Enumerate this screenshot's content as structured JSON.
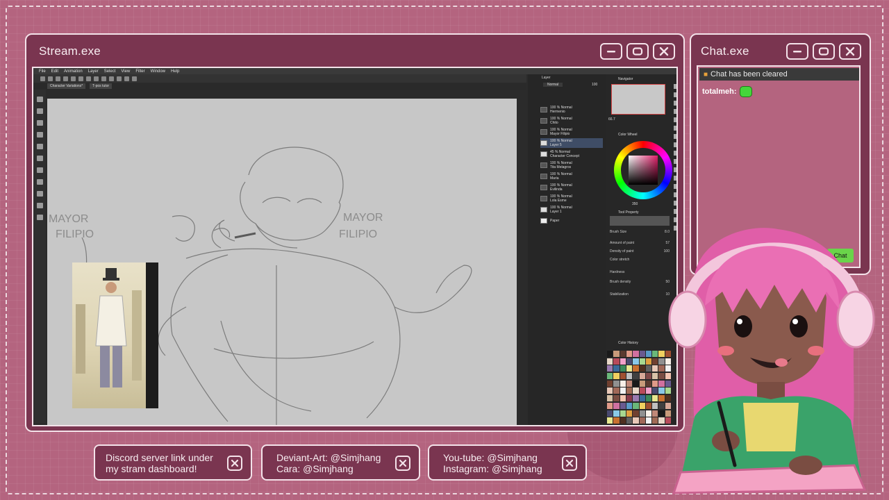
{
  "stream_window": {
    "title": "Stream.exe",
    "app": {
      "menu": [
        "File",
        "Edit",
        "Animation",
        "Layer",
        "Select",
        "View",
        "Filter",
        "Window",
        "Help"
      ],
      "tabs": [
        "Character Variations*",
        "T-pos tutor"
      ],
      "canvas_text": [
        "MAYOR",
        "FILIPIO",
        "MAYOR",
        "FILIPIO"
      ],
      "layers": [
        {
          "opacity": "100 %",
          "mode": "Normal",
          "name": "Hermenio"
        },
        {
          "opacity": "100 %",
          "mode": "Normal",
          "name": "Chito"
        },
        {
          "opacity": "100 %",
          "mode": "Normal",
          "name": "Mayor Filipio"
        },
        {
          "opacity": "100 %",
          "mode": "Normal",
          "name": "Layer 5"
        },
        {
          "opacity": "45 %",
          "mode": "Normal",
          "name": "Character Concept"
        },
        {
          "opacity": "100 %",
          "mode": "Normal",
          "name": "Tita Melagros"
        },
        {
          "opacity": "100 %",
          "mode": "Normal",
          "name": "Maria"
        },
        {
          "opacity": "100 %",
          "mode": "Normal",
          "name": "Evilinda"
        },
        {
          "opacity": "100 %",
          "mode": "Normal",
          "name": "Lola Esme"
        },
        {
          "opacity": "100 %",
          "mode": "Normal",
          "name": "Layer 1"
        },
        {
          "opacity": "",
          "mode": "",
          "name": "Paper"
        }
      ],
      "panels": {
        "layer": "Layer",
        "navigator": "Navigator",
        "color_wheel": "Color Wheel",
        "tool_property": "Tool Property",
        "color_history": "Color History"
      },
      "nav_zoom": "66.7",
      "color_value": "350",
      "tool_properties": [
        {
          "label": "Brush Size",
          "value": "8.0"
        },
        {
          "label": "Amount of paint",
          "value": "57"
        },
        {
          "label": "Density of paint",
          "value": "100"
        },
        {
          "label": "Color stretch",
          "value": ""
        },
        {
          "label": "Hardness",
          "value": ""
        },
        {
          "label": "Brush density",
          "value": "50"
        },
        {
          "label": "Stabilization",
          "value": "10"
        }
      ],
      "blend_mode": "Normal",
      "layer_opacity": "100"
    }
  },
  "chat_window": {
    "title": "Chat.exe",
    "cleared_notice": "Chat has been cleared",
    "messages": [
      {
        "user": "totalmeh:",
        "emote": "green-blob-emote"
      }
    ],
    "chat_button": "Chat"
  },
  "info_boxes": [
    {
      "line1": "Discord server link under",
      "line2": "my stram dashboard!"
    },
    {
      "line1": "Deviant-Art: @Simjhang",
      "line2": "Cara: @Simjhang"
    },
    {
      "line1": "You-tube: @Simjhang",
      "line2": "Instagram: @Simjhang"
    }
  ],
  "colors": {
    "background": "#b4647f",
    "window": "#7a3550",
    "border": "#f4e3ea",
    "chat_emote": "#44d63a"
  }
}
